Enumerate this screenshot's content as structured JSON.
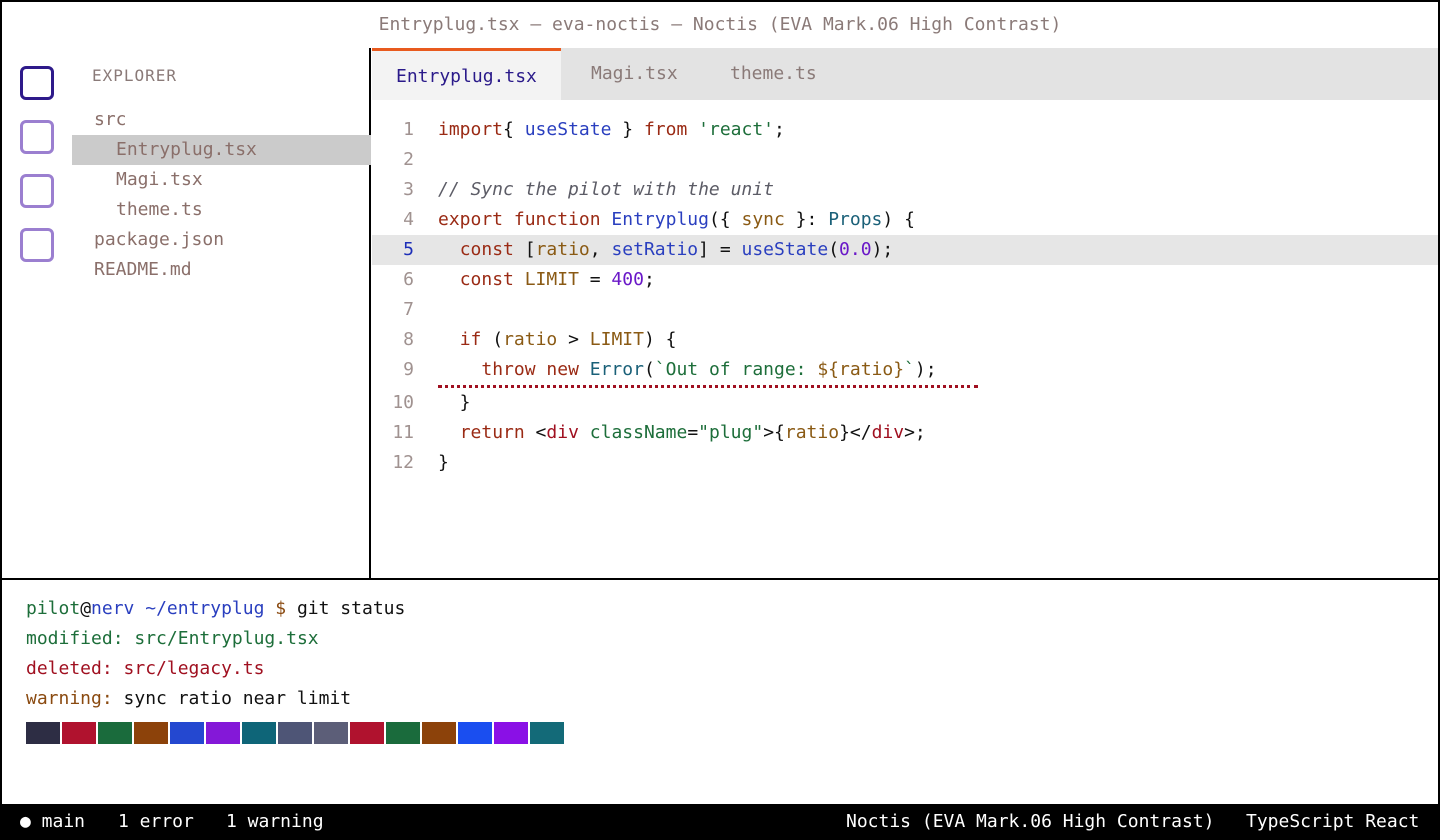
{
  "window": {
    "title": "Entryplug.tsx — eva-noctis — Noctis (EVA Mark.06 High Contrast)"
  },
  "activity_bar": {
    "buttons": [
      "explorer-icon",
      "search-icon",
      "source-control-icon",
      "extensions-icon"
    ]
  },
  "sidebar": {
    "title": "EXPLORER",
    "items": [
      {
        "label": "src",
        "nested": false,
        "selected": false
      },
      {
        "label": "Entryplug.tsx",
        "nested": true,
        "selected": true
      },
      {
        "label": "Magi.tsx",
        "nested": true,
        "selected": false
      },
      {
        "label": "theme.ts",
        "nested": true,
        "selected": false
      },
      {
        "label": "package.json",
        "nested": false,
        "selected": false
      },
      {
        "label": "README.md",
        "nested": false,
        "selected": false
      }
    ]
  },
  "tabs": [
    {
      "label": "Entryplug.tsx",
      "active": true
    },
    {
      "label": "Magi.tsx",
      "active": false
    },
    {
      "label": "theme.ts",
      "active": false
    }
  ],
  "editor": {
    "current_line": 5,
    "error_line": 9,
    "lines": [
      {
        "n": "1",
        "tokens": [
          [
            "kw",
            "import"
          ],
          [
            "",
            "{ "
          ],
          [
            "fn",
            "useState"
          ],
          [
            "",
            " } "
          ],
          [
            "kw",
            "from"
          ],
          [
            "",
            " "
          ],
          [
            "str",
            "'react'"
          ],
          [
            "",
            ";"
          ]
        ]
      },
      {
        "n": "2",
        "tokens": []
      },
      {
        "n": "3",
        "tokens": [
          [
            "cm",
            "// Sync the pilot with the unit"
          ]
        ]
      },
      {
        "n": "4",
        "tokens": [
          [
            "kw",
            "export"
          ],
          [
            "",
            " "
          ],
          [
            "kw",
            "function"
          ],
          [
            "",
            " "
          ],
          [
            "fn",
            "Entryplug"
          ],
          [
            "",
            "({ "
          ],
          [
            "var",
            "sync"
          ],
          [
            "",
            " }: "
          ],
          [
            "ty",
            "Props"
          ],
          [
            "",
            ") {"
          ]
        ]
      },
      {
        "n": "5",
        "tokens": [
          [
            "",
            "  "
          ],
          [
            "kw",
            "const"
          ],
          [
            "",
            " ["
          ],
          [
            "var",
            "ratio"
          ],
          [
            "",
            ", "
          ],
          [
            "fn",
            "setRatio"
          ],
          [
            "",
            "] = "
          ],
          [
            "fn",
            "useState"
          ],
          [
            "",
            "("
          ],
          [
            "num",
            "0.0"
          ],
          [
            "",
            ");"
          ]
        ]
      },
      {
        "n": "6",
        "tokens": [
          [
            "",
            "  "
          ],
          [
            "kw",
            "const"
          ],
          [
            "",
            " "
          ],
          [
            "var",
            "LIMIT"
          ],
          [
            "",
            " = "
          ],
          [
            "num",
            "400"
          ],
          [
            "",
            ";"
          ]
        ]
      },
      {
        "n": "7",
        "tokens": []
      },
      {
        "n": "8",
        "tokens": [
          [
            "",
            "  "
          ],
          [
            "kw",
            "if"
          ],
          [
            "",
            " ("
          ],
          [
            "var",
            "ratio"
          ],
          [
            "",
            " > "
          ],
          [
            "var",
            "LIMIT"
          ],
          [
            "",
            ") {"
          ]
        ]
      },
      {
        "n": "9",
        "tokens": [
          [
            "",
            "    "
          ],
          [
            "kw",
            "throw"
          ],
          [
            "",
            " "
          ],
          [
            "kw",
            "new"
          ],
          [
            "",
            " "
          ],
          [
            "ty",
            "Error"
          ],
          [
            "",
            "("
          ],
          [
            "str",
            "`Out of range: "
          ],
          [
            "var",
            "${ratio}"
          ],
          [
            "str",
            "`"
          ],
          [
            "",
            ");"
          ]
        ]
      },
      {
        "n": "10",
        "tokens": [
          [
            "",
            "  }"
          ]
        ]
      },
      {
        "n": "11",
        "tokens": [
          [
            "",
            "  "
          ],
          [
            "kw",
            "return"
          ],
          [
            "",
            " <"
          ],
          [
            "tag",
            "div"
          ],
          [
            "",
            " "
          ],
          [
            "attr",
            "className"
          ],
          [
            "",
            "="
          ],
          [
            "str",
            "\"plug\""
          ],
          [
            "",
            ">{"
          ],
          [
            "var",
            "ratio"
          ],
          [
            "",
            "}</"
          ],
          [
            "tag",
            "div"
          ],
          [
            "",
            ">;"
          ]
        ]
      },
      {
        "n": "12",
        "tokens": [
          [
            "",
            "}"
          ]
        ]
      }
    ]
  },
  "terminal": {
    "prompt": {
      "user": "pilot",
      "at": "@",
      "host": "nerv",
      "path": " ~/entryplug",
      "symbol": " $",
      "command": " git status"
    },
    "lines": [
      {
        "label": "modified:",
        "value": " src/Entryplug.tsx",
        "color": "#1d6e3a",
        "value_color": "#1d6e3a"
      },
      {
        "label": "deleted:",
        "value": " src/legacy.ts",
        "color": "#a01020",
        "value_color": "#a01020"
      },
      {
        "label": "warning:",
        "value": " sync ratio near limit",
        "color": "#8a4a10",
        "value_color": "#111111"
      }
    ],
    "palette": [
      "#2d2d44",
      "#b0122e",
      "#1a6b3c",
      "#8c420a",
      "#2448d0",
      "#8418d8",
      "#0e6578",
      "#4e5576",
      "#5c5e78",
      "#b0122e",
      "#1a6b3c",
      "#8c420a",
      "#1a4ef0",
      "#8a10e6",
      "#136a78"
    ]
  },
  "statusbar": {
    "branch": "● main",
    "errors": "1 error",
    "warnings": "1 warning",
    "theme": "Noctis (EVA Mark.06 High Contrast)",
    "language": "TypeScript React"
  }
}
